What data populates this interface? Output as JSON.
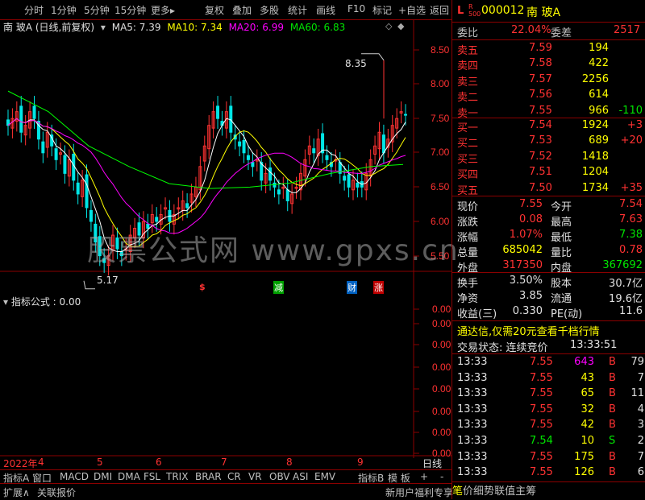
{
  "toolbar": {
    "left": [
      "分时",
      "1分钟",
      "5分钟",
      "15分钟",
      "更多▸"
    ],
    "right": [
      "复权",
      "叠加",
      "多股",
      "统计",
      "画线",
      "F10",
      "标记",
      "+自选",
      "返回"
    ]
  },
  "stock_header": {
    "title": "南 玻A (日线,前复权)",
    "ma5": "MA5: 7.39",
    "ma10": "MA10: 7.34",
    "ma20": "MA20: 6.99",
    "ma60": "MA60: 6.83"
  },
  "price_axis": [
    "8.50",
    "8.00",
    "7.50",
    "7.00",
    "6.50",
    "6.00",
    "5.50"
  ],
  "annotations": {
    "high": "8.35",
    "low": "5.17"
  },
  "markers": [
    "$",
    "减",
    "财",
    "涨"
  ],
  "indicator": {
    "title": "指标公式 : 0.00",
    "axis": [
      "0.00",
      "0.00",
      "0.00",
      "0.00",
      "0.00",
      "0.00",
      "0.00",
      "0.00"
    ]
  },
  "date_axis": {
    "year": "2022年",
    "months": [
      "4",
      "5",
      "6",
      "7",
      "8",
      "9"
    ],
    "period": "日线"
  },
  "indicator_tabs": [
    "指标A",
    "窗口",
    "MACD",
    "DMI",
    "DMA",
    "FSL",
    "TRIX",
    "BRAR",
    "CR",
    "VR",
    "OBV",
    "ASI",
    "EMV",
    "指标B",
    "模 板",
    "+",
    "-"
  ],
  "bottom_bar": {
    "left": [
      "扩展∧",
      "关联报价"
    ],
    "right": "新用户福利专享"
  },
  "quote": {
    "flag": "L",
    "flag_sub": "R 500",
    "code": "000012",
    "name": "南 玻A",
    "webi_label": "委比",
    "webi": "22.04%",
    "weicha_label": "委差",
    "weicha": "2517",
    "sells": [
      {
        "label": "卖五",
        "price": "7.59",
        "vol": "194",
        "chg": ""
      },
      {
        "label": "卖四",
        "price": "7.58",
        "vol": "422",
        "chg": ""
      },
      {
        "label": "卖三",
        "price": "7.57",
        "vol": "2256",
        "chg": ""
      },
      {
        "label": "卖二",
        "price": "7.56",
        "vol": "614",
        "chg": ""
      },
      {
        "label": "卖一",
        "price": "7.55",
        "vol": "966",
        "chg": "-110"
      }
    ],
    "buys": [
      {
        "label": "买一",
        "price": "7.54",
        "vol": "1924",
        "chg": "+3"
      },
      {
        "label": "买二",
        "price": "7.53",
        "vol": "689",
        "chg": "+20"
      },
      {
        "label": "买三",
        "price": "7.52",
        "vol": "1418",
        "chg": ""
      },
      {
        "label": "买四",
        "price": "7.51",
        "vol": "1204",
        "chg": ""
      },
      {
        "label": "买五",
        "price": "7.50",
        "vol": "1734",
        "chg": "+35"
      }
    ],
    "stats": [
      {
        "l1": "现价",
        "v1": "7.55",
        "l2": "今开",
        "v2": "7.54"
      },
      {
        "l1": "涨跌",
        "v1": "0.08",
        "l2": "最高",
        "v2": "7.63"
      },
      {
        "l1": "涨幅",
        "v1": "1.07%",
        "l2": "最低",
        "v2": "7.38"
      },
      {
        "l1": "总量",
        "v1": "685042",
        "l2": "量比",
        "v2": "0.78"
      },
      {
        "l1": "外盘",
        "v1": "317350",
        "l2": "内盘",
        "v2": "367692"
      }
    ],
    "stats2": [
      {
        "l1": "换手",
        "v1": "3.50%",
        "l2": "股本",
        "v2": "30.7亿"
      },
      {
        "l1": "净资",
        "v1": "3.85",
        "l2": "流通",
        "v2": "19.6亿"
      },
      {
        "l1": "收益(三)",
        "v1": "0.330",
        "l2": "PE(动)",
        "v2": "11.6"
      }
    ],
    "ad": "通达信,仅需20元查看千档行情",
    "trade_status": "交易状态: 连续竞价",
    "trade_time": "13:33:51",
    "ticks": [
      {
        "t": "13:33",
        "p": "7.55",
        "v": "643",
        "d": "B",
        "n": "79"
      },
      {
        "t": "13:33",
        "p": "7.55",
        "v": "43",
        "d": "B",
        "n": "7"
      },
      {
        "t": "13:33",
        "p": "7.55",
        "v": "65",
        "d": "B",
        "n": "11"
      },
      {
        "t": "13:33",
        "p": "7.55",
        "v": "32",
        "d": "B",
        "n": "4"
      },
      {
        "t": "13:33",
        "p": "7.55",
        "v": "42",
        "d": "B",
        "n": "3"
      },
      {
        "t": "13:33",
        "p": "7.54",
        "v": "10",
        "d": "S",
        "n": "2"
      },
      {
        "t": "13:33",
        "p": "7.55",
        "v": "175",
        "d": "B",
        "n": "7"
      },
      {
        "t": "13:33",
        "p": "7.55",
        "v": "126",
        "d": "B",
        "n": "6"
      }
    ],
    "bottom_tabs": [
      "笔",
      "价",
      "细",
      "势",
      "联",
      "值",
      "主",
      "筹"
    ]
  },
  "watermark": "股票公式网  www.gpxs.cn",
  "colors": {
    "up": "#ff3232",
    "down": "#00e600",
    "ma5": "#ffffff",
    "ma10": "#ffff00",
    "ma20": "#ff00ff",
    "ma60": "#00ff00",
    "border": "#8b0000"
  }
}
